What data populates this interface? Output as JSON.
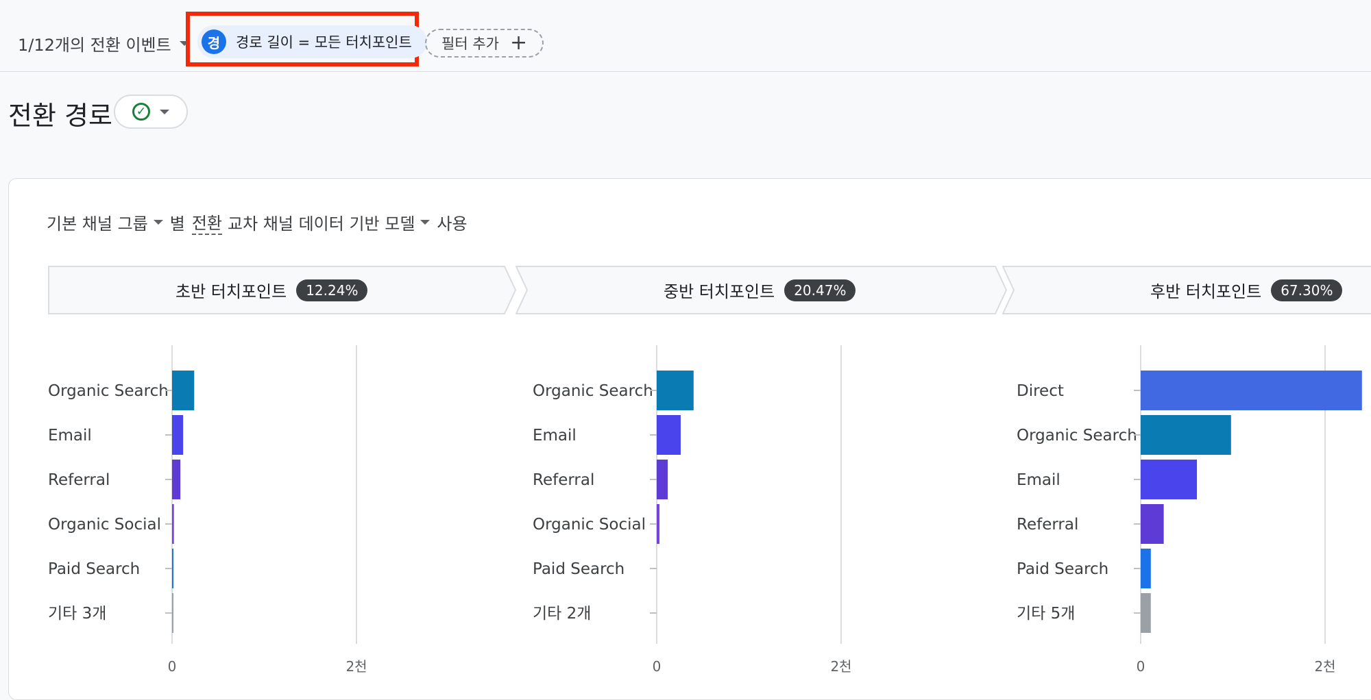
{
  "topbar": {
    "conversion_events_label": "1/12개의 전환 이벤트",
    "filter_chip": {
      "avatar_letter": "경",
      "label": "경로 길이 = 모든 터치포인트"
    },
    "add_filter_label": "필터 추가",
    "highlight_color": "#f22a0c"
  },
  "page_title": "전환 경로",
  "config": {
    "dimension_label": "기본 채널 그룹",
    "by_label": "별",
    "conversion_label": "전환",
    "model_label": "교차 채널 데이터 기반 모델",
    "use_label": "사용"
  },
  "stages": [
    {
      "label": "초반 터치포인트",
      "badge": "12.24%"
    },
    {
      "label": "중반 터치포인트",
      "badge": "20.47%"
    },
    {
      "label": "후반 터치포인트",
      "badge": "67.30%"
    }
  ],
  "chart_data": [
    {
      "type": "bar",
      "orientation": "horizontal",
      "categories": [
        "Organic Search",
        "Email",
        "Referral",
        "Organic Social",
        "Paid Search",
        "기타 3개"
      ],
      "values": [
        240,
        120,
        90,
        20,
        8,
        6
      ],
      "colors": [
        "#0a7bb3",
        "#4a44ec",
        "#5f3bd6",
        "#7c3fe0",
        "#1a73e8",
        "#9aa0a6"
      ],
      "xlim": [
        0,
        2000
      ],
      "tick_labels": [
        "0",
        "2천"
      ]
    },
    {
      "type": "bar",
      "orientation": "horizontal",
      "categories": [
        "Organic Search",
        "Email",
        "Referral",
        "Organic Social",
        "Paid Search",
        "기타 2개"
      ],
      "values": [
        400,
        260,
        120,
        30,
        0,
        0
      ],
      "colors": [
        "#0a7bb3",
        "#4a44ec",
        "#5f3bd6",
        "#7c3fe0",
        "#1a73e8",
        "#9aa0a6"
      ],
      "xlim": [
        0,
        2000
      ],
      "tick_labels": [
        "0",
        "2천"
      ]
    },
    {
      "type": "bar",
      "orientation": "horizontal",
      "categories": [
        "Direct",
        "Organic Search",
        "Email",
        "Referral",
        "Paid Search",
        "기타 5개"
      ],
      "values": [
        2400,
        980,
        610,
        250,
        110,
        110
      ],
      "colors": [
        "#4169e1",
        "#0a7bb3",
        "#4a44ec",
        "#5f3bd6",
        "#1a73e8",
        "#9aa0a6"
      ],
      "xlim": [
        0,
        2000
      ],
      "tick_labels": [
        "0",
        "2천"
      ]
    }
  ]
}
